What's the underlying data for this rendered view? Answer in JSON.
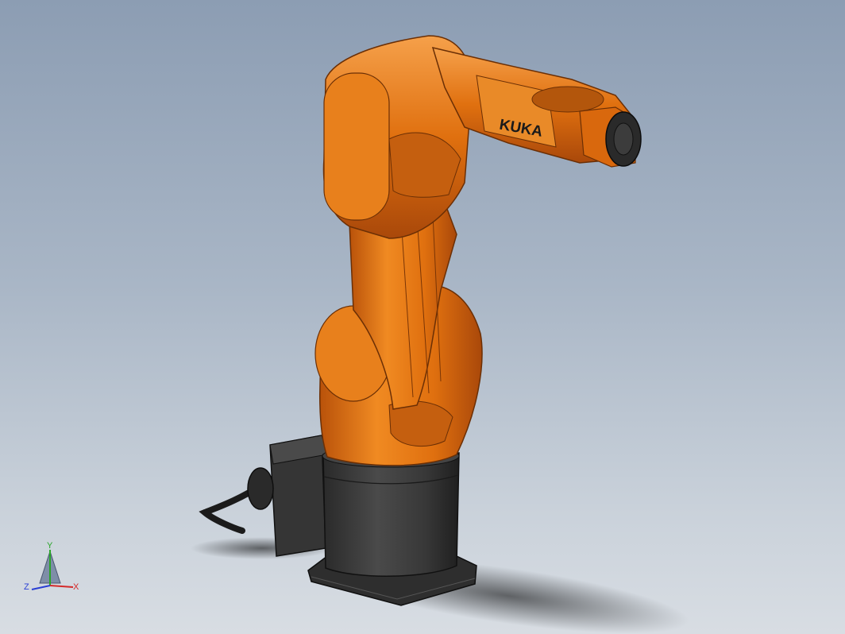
{
  "scene": {
    "background_top": "#8c9db3",
    "background_bottom": "#d8dde3",
    "robot_brand": "KUKA",
    "arm_color": "#e0700f",
    "base_color": "#3a3a3a"
  },
  "triad": {
    "x_label": "X",
    "y_label": "Y",
    "z_label": "Z",
    "x_color": "#d42a2a",
    "y_color": "#2aa52a",
    "z_color": "#2a3fd4"
  }
}
